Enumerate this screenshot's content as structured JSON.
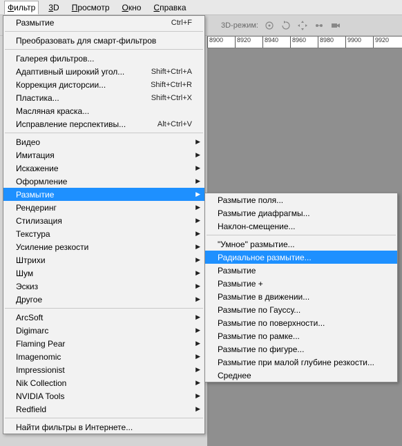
{
  "menubar": {
    "items": [
      {
        "label": "Фильтр",
        "active": true,
        "u": 0
      },
      {
        "label": "3D",
        "u": 0
      },
      {
        "label": "Просмотр",
        "u": 0
      },
      {
        "label": "Окно",
        "u": 0
      },
      {
        "label": "Справка",
        "u": 0
      }
    ]
  },
  "toolbar": {
    "label_3d": "3D-режим:"
  },
  "ruler": {
    "ticks": [
      "8900",
      "8920",
      "8940",
      "8960",
      "8980",
      "9900",
      "9920"
    ]
  },
  "menu": {
    "groups": [
      [
        {
          "label": "Размытие",
          "shortcut": "Ctrl+F"
        }
      ],
      [
        {
          "label": "Преобразовать для смарт-фильтров"
        }
      ],
      [
        {
          "label": "Галерея фильтров..."
        },
        {
          "label": "Адаптивный широкий угол...",
          "shortcut": "Shift+Ctrl+A"
        },
        {
          "label": "Коррекция дисторсии...",
          "shortcut": "Shift+Ctrl+R"
        },
        {
          "label": "Пластика...",
          "shortcut": "Shift+Ctrl+X"
        },
        {
          "label": "Масляная краска..."
        },
        {
          "label": "Исправление перспективы...",
          "shortcut": "Alt+Ctrl+V"
        }
      ],
      [
        {
          "label": "Видео",
          "sub": true
        },
        {
          "label": "Имитация",
          "sub": true
        },
        {
          "label": "Искажение",
          "sub": true
        },
        {
          "label": "Оформление",
          "sub": true
        },
        {
          "label": "Размытие",
          "sub": true,
          "hl": true
        },
        {
          "label": "Рендеринг",
          "sub": true
        },
        {
          "label": "Стилизация",
          "sub": true
        },
        {
          "label": "Текстура",
          "sub": true
        },
        {
          "label": "Усиление резкости",
          "sub": true
        },
        {
          "label": "Штрихи",
          "sub": true
        },
        {
          "label": "Шум",
          "sub": true
        },
        {
          "label": "Эскиз",
          "sub": true
        },
        {
          "label": "Другое",
          "sub": true
        }
      ],
      [
        {
          "label": "ArcSoft",
          "sub": true
        },
        {
          "label": "Digimarc",
          "sub": true
        },
        {
          "label": "Flaming Pear",
          "sub": true
        },
        {
          "label": "Imagenomic",
          "sub": true
        },
        {
          "label": "Impressionist",
          "sub": true
        },
        {
          "label": "Nik Collection",
          "sub": true
        },
        {
          "label": "NVIDIA Tools",
          "sub": true
        },
        {
          "label": "Redfield",
          "sub": true
        }
      ],
      [
        {
          "label": "Найти фильтры в Интернете..."
        }
      ]
    ]
  },
  "submenu": {
    "groups": [
      [
        {
          "label": "Размытие поля..."
        },
        {
          "label": "Размытие диафрагмы..."
        },
        {
          "label": "Наклон-смещение..."
        }
      ],
      [
        {
          "label": "\"Умное\" размытие..."
        },
        {
          "label": "Радиальное размытие...",
          "hl": true
        },
        {
          "label": "Размытие"
        },
        {
          "label": "Размытие +"
        },
        {
          "label": "Размытие в движении..."
        },
        {
          "label": "Размытие по Гауссу..."
        },
        {
          "label": "Размытие по поверхности..."
        },
        {
          "label": "Размытие по рамке..."
        },
        {
          "label": "Размытие по фигуре..."
        },
        {
          "label": "Размытие при малой глубине резкости..."
        },
        {
          "label": "Среднее"
        }
      ]
    ]
  }
}
